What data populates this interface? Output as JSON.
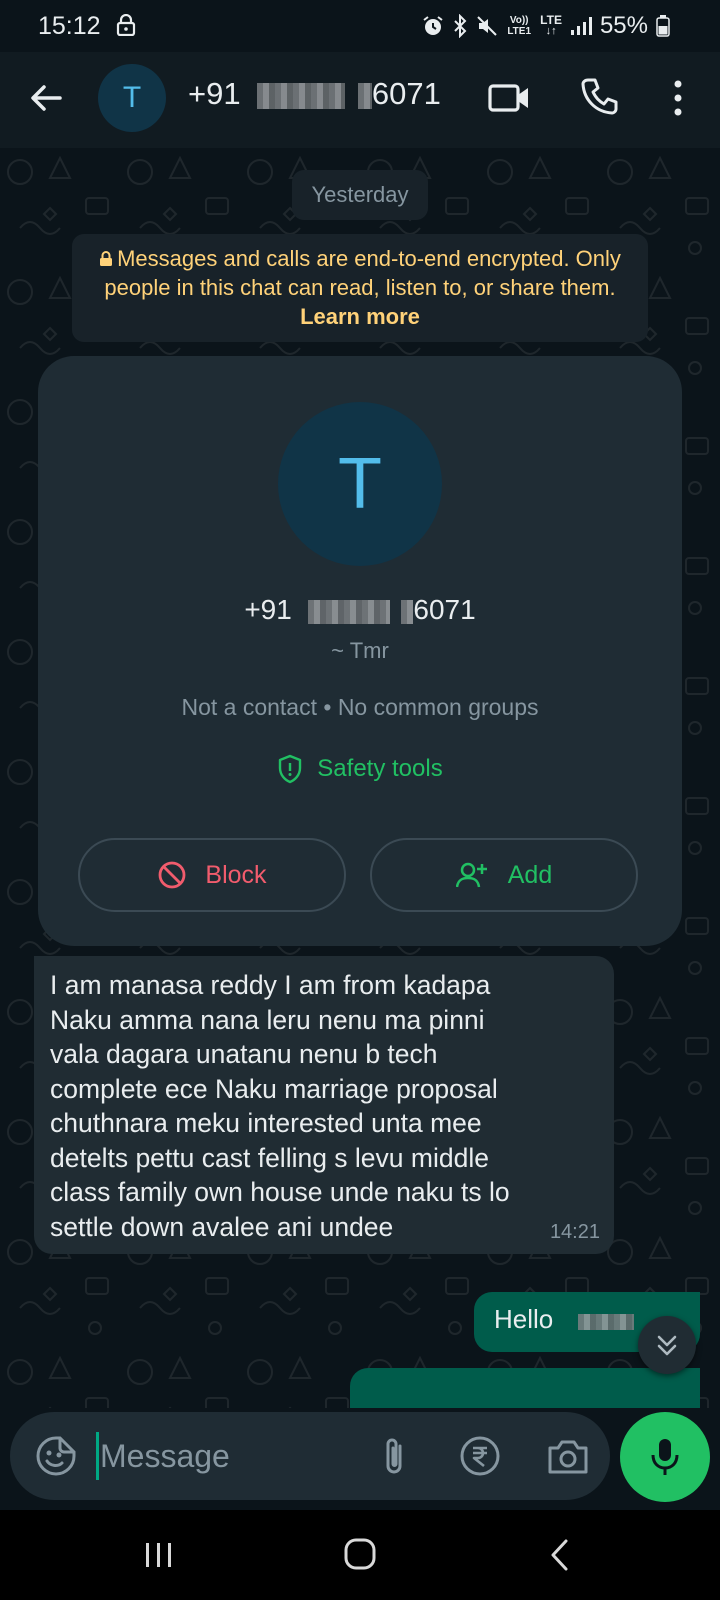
{
  "status_bar": {
    "time": "15:12",
    "network": "LTE",
    "volte": "Vo)) LTE1",
    "battery": "55%"
  },
  "header": {
    "avatar_letter": "T",
    "phone_prefix": "+91",
    "phone_suffix": "6071"
  },
  "chat": {
    "date_chip": "Yesterday",
    "encryption_notice": "Messages and calls are end-to-end encrypted. Only people in this chat can read, listen to, or share them.",
    "learn_more": "Learn more",
    "profile_card": {
      "avatar_letter": "T",
      "phone_prefix": "+91",
      "phone_suffix": "6071",
      "alias": "~ Tmr",
      "meta": "Not a contact • No common groups",
      "safety_tools": "Safety tools",
      "block_label": "Block",
      "add_label": "Add"
    },
    "incoming_message": {
      "lines": [
        "I am manasa reddy I am from kadapa",
        "Naku amma nana leru nenu ma pinni",
        "vala dagara unatanu nenu b tech",
        "complete ece Naku marriage proposal",
        "chuthnara meku interested unta mee",
        "detelts pettu cast felling s levu middle",
        "class family own house unde naku ts lo",
        "settle down avalee ani undee"
      ],
      "time": "14:21"
    },
    "outgoing_message": {
      "text": "Hello"
    }
  },
  "input": {
    "placeholder": "Message"
  },
  "colors": {
    "background": "#0b141a",
    "header": "#111b21",
    "bubble_in": "#202c33",
    "bubble_out": "#005c4b",
    "accent_green": "#21c063",
    "encryption_text": "#ffd279",
    "block_red": "#f15c6d",
    "avatar_bg": "#103447",
    "avatar_letter": "#53bdeb"
  }
}
